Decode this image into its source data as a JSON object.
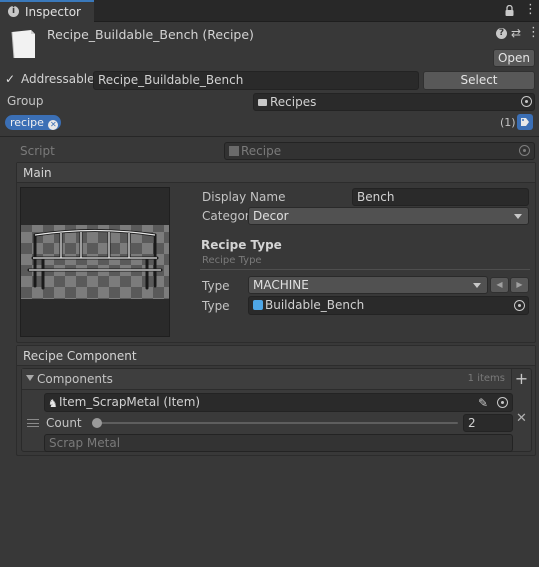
{
  "tab": {
    "title": "Inspector"
  },
  "header": {
    "asset_title": "Recipe_Buildable_Bench (Recipe)",
    "open_label": "Open"
  },
  "addressable": {
    "label": "Addressable",
    "checked": true,
    "address": "Recipe_Buildable_Bench",
    "select_label": "Select"
  },
  "group": {
    "label": "Group",
    "value": "Recipes"
  },
  "labels": {
    "tag": "recipe",
    "count": "(1)"
  },
  "script": {
    "label": "Script",
    "value": "Recipe"
  },
  "main": {
    "title": "Main",
    "display_name_label": "Display Name",
    "display_name_value": "Bench",
    "category_label": "Categor",
    "category_value": "Decor",
    "recipe_type_heading": "Recipe Type",
    "recipe_type_subheading": "Recipe Type",
    "type_label": "Type",
    "type_value": "MACHINE",
    "type2_label": "Type",
    "type2_value": "Buildable_Bench"
  },
  "recipe_component": {
    "title": "Recipe Component",
    "components_label": "Components",
    "items_count": "1 items",
    "item_ref": "Item_ScrapMetal (Item)",
    "count_label": "Count",
    "count_value": "2",
    "count_fraction": 0.0,
    "item_name": "Scrap Metal"
  },
  "colors": {
    "background": "#383838",
    "tag_blue": "#3b6fb5",
    "field": "#2a2a2a"
  },
  "icons": [
    "info-icon",
    "lock-icon",
    "menu-icon",
    "help-icon",
    "settings-icon",
    "more-icon",
    "checkbox-icon",
    "folder-icon",
    "tag-close-icon",
    "tag-icon",
    "script-icon",
    "target-icon",
    "chevron-down-icon",
    "arrow-left-icon",
    "arrow-right-icon",
    "prefab-icon",
    "item-icon",
    "edit-icon",
    "plus-icon",
    "drag-handle-icon",
    "remove-icon"
  ]
}
